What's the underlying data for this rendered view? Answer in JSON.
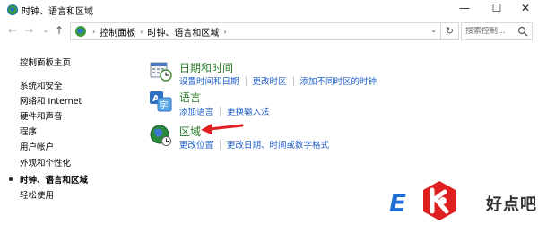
{
  "window": {
    "title": "时钟、语言和区域",
    "minimize_glyph": "—",
    "maximize_glyph": "☐",
    "close_glyph": "✕"
  },
  "nav": {
    "back_glyph": "←",
    "forward_glyph": "→",
    "recent_glyph": "⌄",
    "up_glyph": "↑",
    "breadcrumb": [
      "控制面板",
      "时钟、语言和区域"
    ],
    "separator": "›",
    "dropdown_glyph": "⌄",
    "refresh_glyph": "↻",
    "search_placeholder": "搜索控制..."
  },
  "sidebar": {
    "items": [
      {
        "label": "控制面板主页"
      },
      {
        "label": "系统和安全"
      },
      {
        "label": "网络和 Internet"
      },
      {
        "label": "硬件和声音"
      },
      {
        "label": "程序"
      },
      {
        "label": "用户帐户"
      },
      {
        "label": "外观和个性化"
      },
      {
        "label": "时钟、语言和区域",
        "current": true
      },
      {
        "label": "轻松使用"
      }
    ]
  },
  "categories": [
    {
      "title": "日期和时间",
      "icon": "calendar-clock-icon",
      "links": [
        "设置时间和日期",
        "更改时区",
        "添加不同时区的时钟"
      ]
    },
    {
      "title": "语言",
      "icon": "language-icon",
      "links": [
        "添加语言",
        "更换输入法"
      ]
    },
    {
      "title": "区域",
      "icon": "globe-clock-icon",
      "links": [
        "更改位置",
        "更改日期、时间或数字格式"
      ]
    }
  ],
  "watermark": {
    "text": "好点吧"
  },
  "colors": {
    "link": "#1e5ec8",
    "category_title": "#2a7a2a",
    "annotation_arrow": "#e02020",
    "watermark_red": "#e02020",
    "watermark_blue": "#1f6fd6"
  }
}
